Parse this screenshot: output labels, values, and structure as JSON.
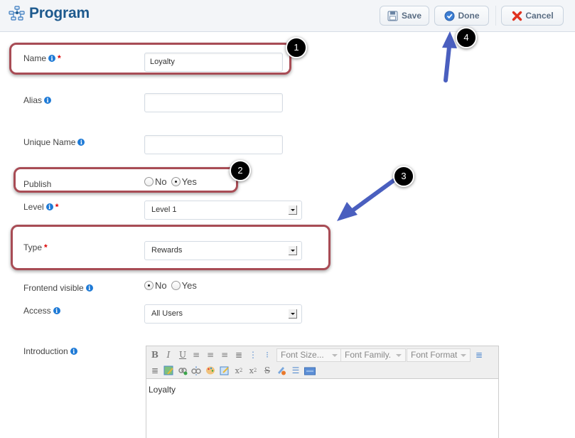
{
  "header": {
    "title": "Program",
    "title_icon": "sitemap-icon",
    "buttons": {
      "save": {
        "label": "Save",
        "icon": "floppy-disk-icon"
      },
      "done": {
        "label": "Done",
        "icon": "checkmark-circle-icon"
      },
      "cancel": {
        "label": "Cancel",
        "icon": "red-x-icon"
      }
    }
  },
  "form": {
    "name": {
      "label": "Name",
      "value": "Loyalty",
      "required": "*"
    },
    "alias": {
      "label": "Alias",
      "value": ""
    },
    "unique_name": {
      "label": "Unique Name",
      "value": ""
    },
    "publish": {
      "label": "Publish",
      "options": [
        "No",
        "Yes"
      ],
      "selected": "Yes"
    },
    "level": {
      "label": "Level",
      "value": "Level 1",
      "required": "*"
    },
    "type": {
      "label": "Type",
      "value": "Rewards",
      "required": "*"
    },
    "frontend_visible": {
      "label": "Frontend visible",
      "options": [
        "No",
        "Yes"
      ],
      "selected": "No"
    },
    "access": {
      "label": "Access",
      "value": "All Users"
    },
    "introduction": {
      "label": "Introduction",
      "content": "Loyalty",
      "toolbar": {
        "font_size": "Font Size...",
        "font_family": "Font Family.",
        "font_format": "Font Format",
        "tools": [
          "bold",
          "italic",
          "underline",
          "align-left",
          "align-center",
          "align-right",
          "align-justify",
          "ordered-list",
          "unordered-list",
          "indent",
          "outdent",
          "image",
          "link",
          "unlink",
          "color-palette",
          "edit",
          "subscript",
          "superscript",
          "strikethrough",
          "remove-format",
          "horizontal-rule",
          "html"
        ]
      }
    }
  },
  "annotations": {
    "badge1": "1",
    "badge2": "2",
    "badge3": "3",
    "badge4": "4",
    "callout_color": "#a84c55",
    "arrow_color": "#4a5fbf"
  }
}
